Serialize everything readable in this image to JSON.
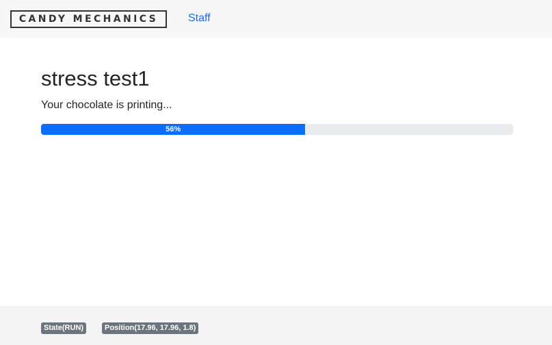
{
  "navbar": {
    "brand": "CANDY MECHANICS",
    "links": [
      {
        "label": "Staff"
      }
    ]
  },
  "main": {
    "title": "stress test1",
    "status_text": "Your chocolate is printing...",
    "progress": {
      "value_percent": 56,
      "label": "56%"
    }
  },
  "footer": {
    "badges": [
      {
        "label": "State(RUN)"
      },
      {
        "label": "Position(17.96, 17.96, 1.8)"
      }
    ]
  },
  "colors": {
    "accent": "#0d6efd",
    "progress_track": "#e9ecef",
    "badge_bg": "#6c757d",
    "navbar_bg": "#f7f7f8",
    "footer_bg": "#f4f4f5"
  }
}
